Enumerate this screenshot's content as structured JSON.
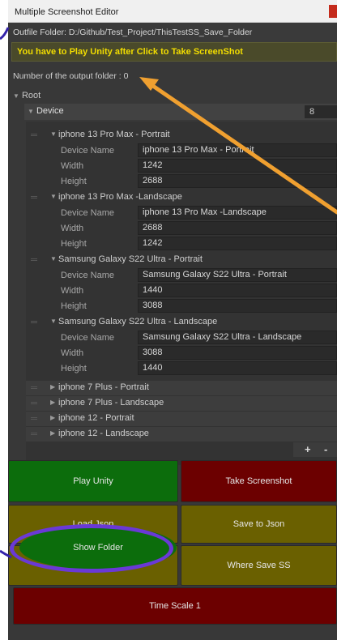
{
  "window": {
    "title": "Multiple Screenshot Editor"
  },
  "outfile": {
    "text": "Outfile Folder: D:/Github/Test_Project/ThisTestSS_Save_Folder"
  },
  "warning": {
    "text": "You have to Play Unity after Click to Take ScreenShot"
  },
  "output_folder": {
    "text": "Number of the output folder : 0"
  },
  "tree": {
    "root_label": "Root",
    "device_label": "Device",
    "device_count": "8"
  },
  "field_labels": {
    "device_name": "Device Name",
    "width": "Width",
    "height": "Height"
  },
  "devices": [
    {
      "name": "iphone 13 Pro Max - Portrait",
      "device_name": "iphone 13 Pro Max - Portrait",
      "width": "1242",
      "height": "2688"
    },
    {
      "name": "iphone 13 Pro Max -Landscape",
      "device_name": "iphone 13 Pro Max -Landscape",
      "width": "2688",
      "height": "1242"
    },
    {
      "name": "Samsung Galaxy S22 Ultra - Portrait",
      "device_name": "Samsung Galaxy S22 Ultra - Portrait",
      "width": "1440",
      "height": "3088"
    },
    {
      "name": "Samsung Galaxy S22 Ultra - Landscape",
      "device_name": "Samsung Galaxy S22 Ultra - Landscape",
      "width": "3088",
      "height": "1440"
    }
  ],
  "collapsed_devices": [
    "iphone 7 Plus - Portrait",
    "iphone 7 Plus - Landscape",
    "iphone 12 - Portrait",
    "iphone 12 - Landscape"
  ],
  "list_controls": {
    "add": "+",
    "remove": "-"
  },
  "buttons": {
    "play_unity": "Play Unity",
    "take_screenshot": "Take Screenshot",
    "load_json": "Load Json",
    "save_to_json": "Save to Json",
    "show_folder": "Show Folder",
    "where_save_ss": "Where Save SS",
    "time_scale": "Time Scale 1"
  },
  "colors": {
    "green_button": "#0c6d0c",
    "red_button": "#6c0000",
    "olive_button": "#6a6000",
    "warning_text": "#f2dd00",
    "annotation": "#6a39d6",
    "arrow": "#f0a030"
  }
}
